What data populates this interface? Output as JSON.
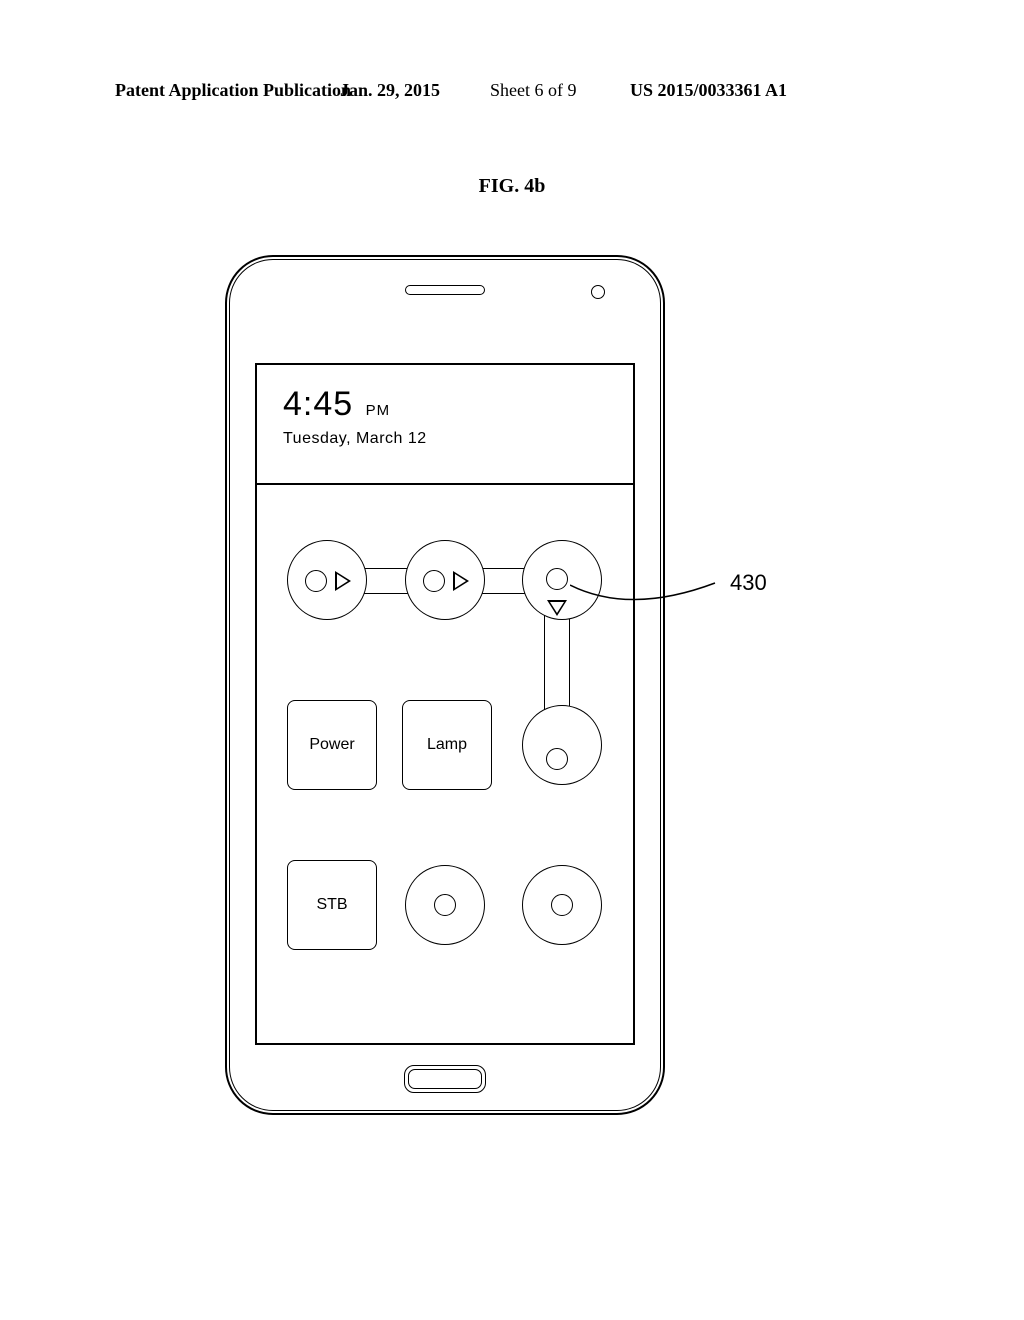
{
  "header": {
    "left": "Patent Application Publication",
    "date": "Jan. 29, 2015",
    "sheet": "Sheet 6 of 9",
    "pubno": "US 2015/0033361 A1"
  },
  "figure": {
    "label": "FIG. 4b",
    "callout_ref": "430"
  },
  "lockscreen": {
    "time": "4:45",
    "ampm": "PM",
    "date": "Tuesday, March 12"
  },
  "buttons": {
    "power": "Power",
    "lamp": "Lamp",
    "stb": "STB"
  }
}
